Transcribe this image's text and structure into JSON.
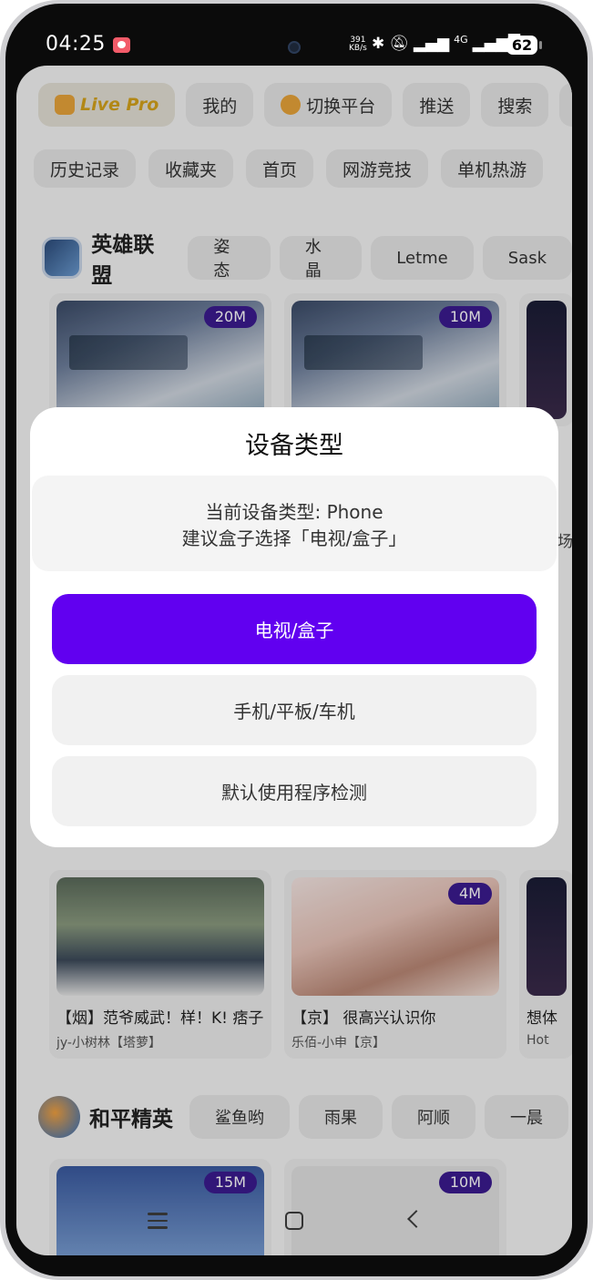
{
  "status_bar": {
    "time": "04:25",
    "net_speed_value": "391",
    "net_speed_unit": "KB/s",
    "signal_label": "4G",
    "battery": "62"
  },
  "top_chips": [
    {
      "label": "Live Pro"
    },
    {
      "label": "我的"
    },
    {
      "label": "切换平台"
    },
    {
      "label": "推送"
    },
    {
      "label": "搜索"
    },
    {
      "label": "·"
    }
  ],
  "category_chips": [
    "历史记录",
    "收藏夹",
    "首页",
    "网游竞技",
    "单机热游"
  ],
  "section_lol": {
    "title": "英雄联盟",
    "tags": [
      "姿态",
      "水晶",
      "Letme",
      "Sask"
    ],
    "cards": [
      {
        "viewers": "20M",
        "thumb_text": "传奇争锋夺宝 赢iG冠军臻彩"
      },
      {
        "viewers": "10M",
        "thumb_text": "传奇争锋夺宝 赢iG冠军臻彩"
      }
    ]
  },
  "section_entertainment": {
    "cards": [
      {
        "viewers": "",
        "title": "【烟】范爷威武！样！K! 痞子",
        "streamer": "jy-小树林【塔萝】"
      },
      {
        "viewers": "4M",
        "title": "【京】 很高兴认识你",
        "streamer": "乐佰-小申【京】"
      },
      {
        "viewers": "",
        "title": "想体",
        "streamer": "Hot"
      }
    ]
  },
  "section_pubg": {
    "title": "和平精英",
    "tags": [
      "鲨鱼哟",
      "雨果",
      "阿顺",
      "一晨"
    ],
    "cards": [
      {
        "viewers": "15M"
      },
      {
        "viewers": "10M"
      }
    ]
  },
  "dialog": {
    "title": "设备类型",
    "message_line1": "当前设备类型: Phone",
    "message_line2": "建议盒子选择「电视/盒子」",
    "options": [
      {
        "label": "电视/盒子",
        "selected": true
      },
      {
        "label": "手机/平板/车机",
        "selected": false
      },
      {
        "label": "默认使用程序检测",
        "selected": false
      }
    ],
    "accent_color": "#6100f0"
  },
  "side_hint": "场"
}
